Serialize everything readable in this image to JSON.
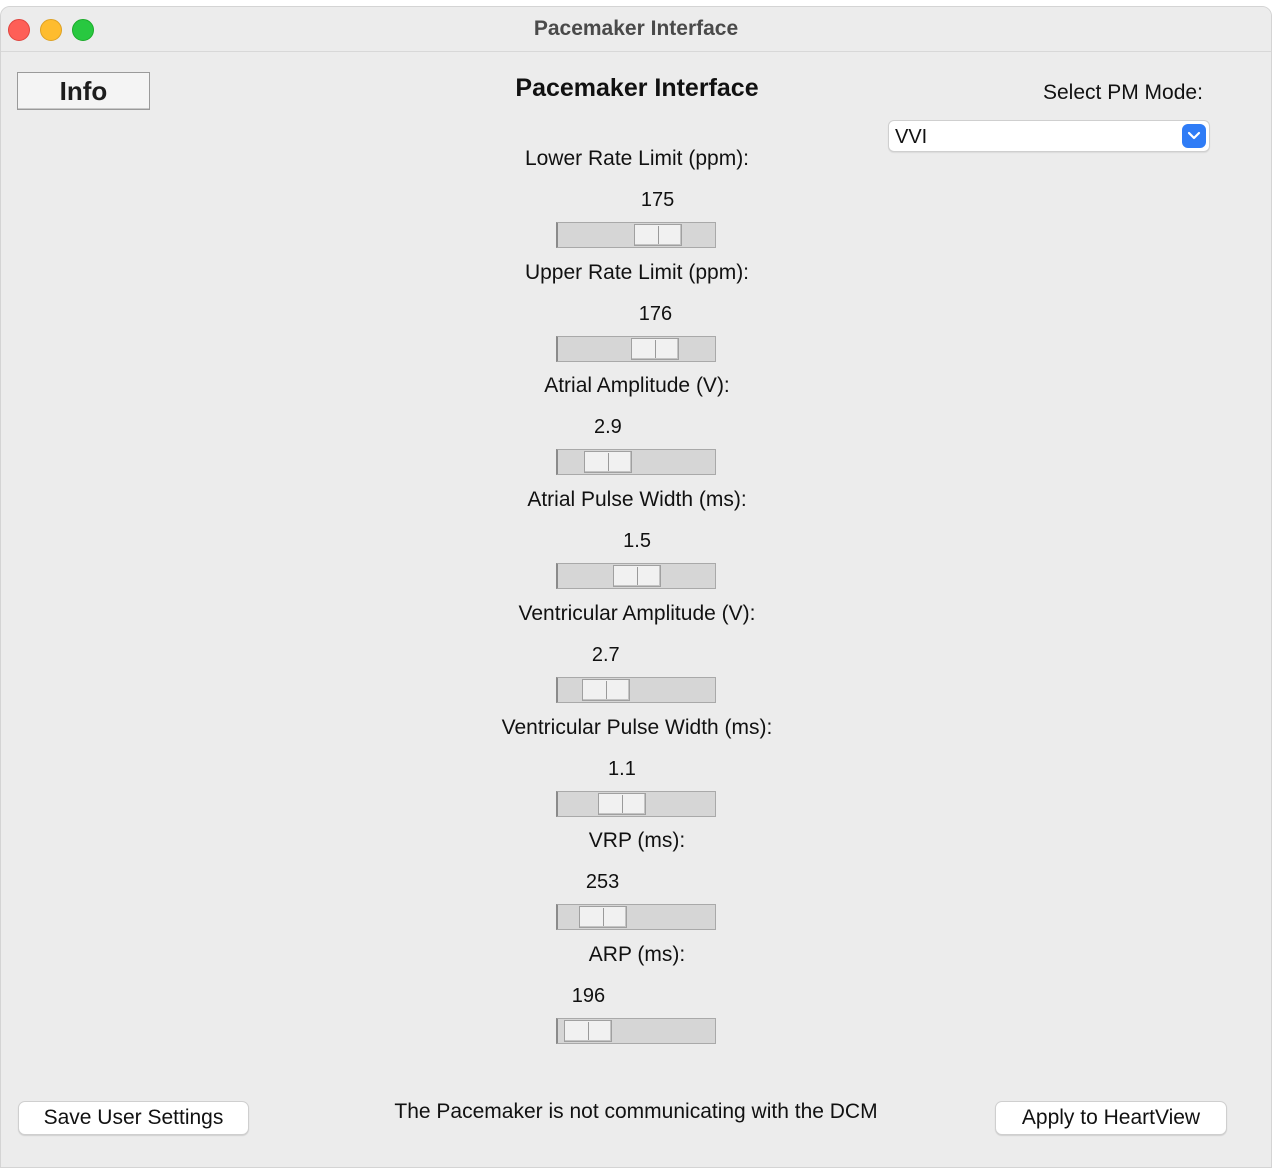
{
  "window": {
    "title": "Pacemaker Interface"
  },
  "header": {
    "info_label": "Info",
    "title": "Pacemaker Interface"
  },
  "mode": {
    "label": "Select PM Mode:",
    "value": "VVI"
  },
  "params": [
    {
      "label": "Lower Rate Limit (ppm):",
      "value": "175",
      "level": 0.7
    },
    {
      "label": "Upper Rate Limit (ppm):",
      "value": "176",
      "level": 0.68
    },
    {
      "label": "Atrial Amplitude (V):",
      "value": "2.9",
      "level": 0.24
    },
    {
      "label": "Atrial Pulse Width (ms):",
      "value": "1.5",
      "level": 0.51
    },
    {
      "label": "Ventricular Amplitude (V):",
      "value": "2.7",
      "level": 0.22
    },
    {
      "label": "Ventricular Pulse Width (ms):",
      "value": "1.1",
      "level": 0.37
    },
    {
      "label": "VRP (ms):",
      "value": "253",
      "level": 0.19
    },
    {
      "label": "ARP (ms):",
      "value": "196",
      "level": 0.06
    }
  ],
  "footer": {
    "save_label": "Save User Settings",
    "status": "The Pacemaker is not communicating with the DCM",
    "apply_label": "Apply to HeartView"
  }
}
